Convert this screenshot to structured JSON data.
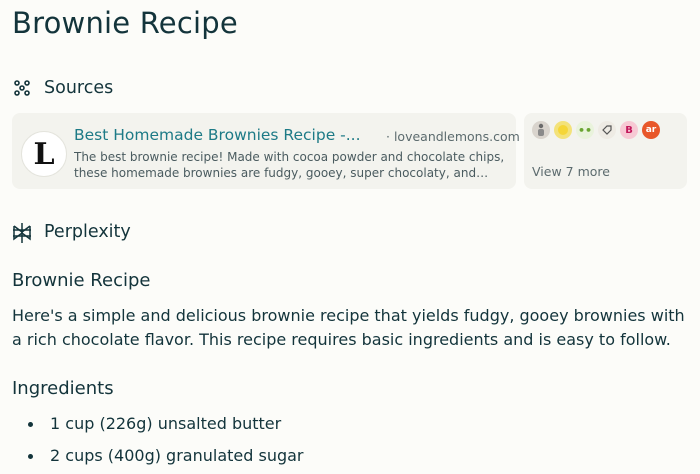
{
  "page": {
    "title": "Brownie Recipe"
  },
  "sources": {
    "heading": "Sources",
    "icon": "sources-icon",
    "items": [
      {
        "title": "Best Homemade Brownies Recipe -...",
        "domain": "· loveandlemons.com",
        "snippet": "The best brownie recipe! Made with cocoa powder and chocolate chips, these homemade brownies are fudgy, gooey, super chocolaty, and easy to...",
        "logo_letter": "L"
      }
    ],
    "more": {
      "label": "View 7 more",
      "favicons": [
        {
          "name": "chef-figure-icon",
          "color": "#c8c3bd",
          "glyph": ""
        },
        {
          "name": "lemon-icon",
          "color": "#f3e27a",
          "glyph": ""
        },
        {
          "name": "green-dots-icon",
          "color": "#8bc34a",
          "glyph": "••"
        },
        {
          "name": "tag-icon",
          "color": "#e8e4dc",
          "glyph": ""
        },
        {
          "name": "b-logo-icon",
          "color": "#f7c9d4",
          "glyph": "B"
        },
        {
          "name": "ar-logo-icon",
          "color": "#e8572a",
          "glyph": "ar"
        }
      ]
    }
  },
  "answer": {
    "heading": "Perplexity",
    "icon": "perplexity-logo-icon",
    "title": "Brownie Recipe",
    "intro": "Here's a simple and delicious brownie recipe that yields fudgy, gooey brownies with a rich chocolate flavor. This recipe requires basic ingredients and is easy to follow.",
    "ingredients_heading": "Ingredients",
    "ingredients": [
      "1 cup (226g) unsalted butter",
      "2 cups (400g) granulated sugar"
    ]
  },
  "colors": {
    "background": "#fcfcf9",
    "text": "#13343b",
    "link": "#1d7a86",
    "card": "#f3f3ee"
  }
}
